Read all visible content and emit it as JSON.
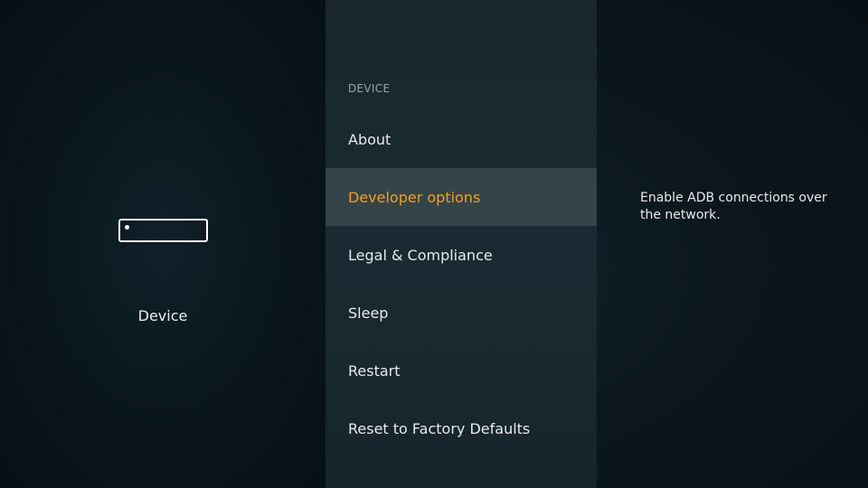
{
  "left_panel": {
    "icon": "fire-tv-device-icon",
    "label": "Device"
  },
  "menu": {
    "header": "DEVICE",
    "items": [
      {
        "label": "About",
        "selected": false
      },
      {
        "label": "Developer options",
        "selected": true
      },
      {
        "label": "Legal & Compliance",
        "selected": false
      },
      {
        "label": "Sleep",
        "selected": false
      },
      {
        "label": "Restart",
        "selected": false
      },
      {
        "label": "Reset to Factory Defaults",
        "selected": false
      }
    ]
  },
  "description": {
    "text": "Enable ADB connections over the network."
  },
  "colors": {
    "background": "#0a1319",
    "menu_background": "#1b2a32",
    "selected_background": "#35434a",
    "selected_text": "#f0a11f",
    "text": "#e6eaec",
    "header_text": "#9aa5ab"
  }
}
